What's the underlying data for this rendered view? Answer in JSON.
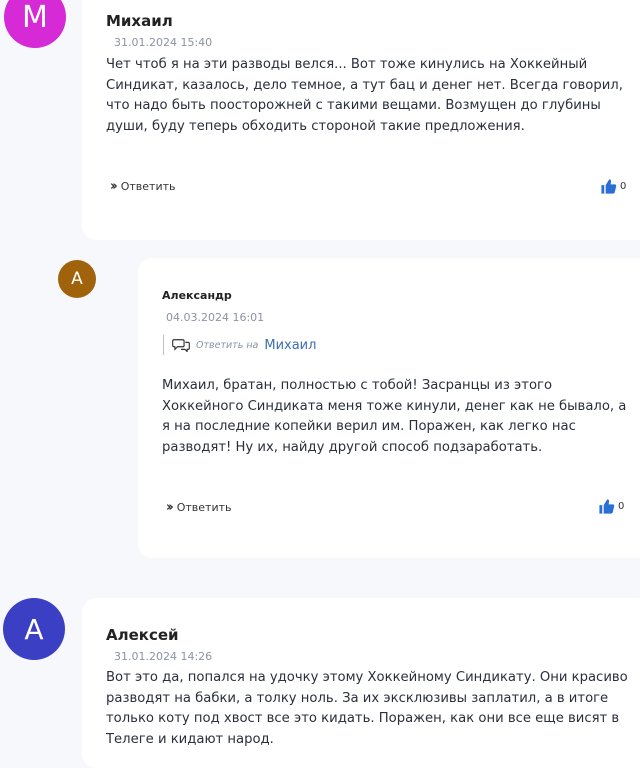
{
  "comments": [
    {
      "avatar_letter": "M",
      "avatar_color": "#d52ad5",
      "author": "Михаил",
      "date": "31.01.2024 15:40",
      "text": "Чет чтоб я на эти разводы велся... Вот тоже кинулись на Хоккейный Синдикат, казалось, дело темное, а тут бац и денег нет. Всегда говорил, что надо быть поосторожней с такими вещами. Возмущен до глубины души, буду теперь обходить стороной такие предложения.",
      "reply_label": "Ответить",
      "likes": "0"
    },
    {
      "avatar_letter": "А",
      "avatar_color": "#a0620a",
      "author": "Александр",
      "date": "04.03.2024 16:01",
      "reply_to_prefix": "Ответить на",
      "reply_to_name": "Михаил",
      "text": "Михаил, братан, полностью с тобой! Засранцы из этого Хоккейного Синдиката меня тоже кинули, денег как не бывало, а я на последние копейки верил им. Поражен, как легко нас разводят! Ну их, найду другой способ подзаработать.",
      "reply_label": "Ответить",
      "likes": "0"
    },
    {
      "avatar_letter": "А",
      "avatar_color": "#3b3fc4",
      "author": "Алексей",
      "date": "31.01.2024 14:26",
      "text": "Вот это да, попался на удочку этому Хоккейному Синдикату. Они красиво разводят на бабки, а толку ноль. За их эксклюзивы заплатил, а в итоге только коту под хвост все это кидать. Поражен, как они все еще висят в Телеге и кидают народ."
    }
  ],
  "accent_color": "#2a6fd6"
}
